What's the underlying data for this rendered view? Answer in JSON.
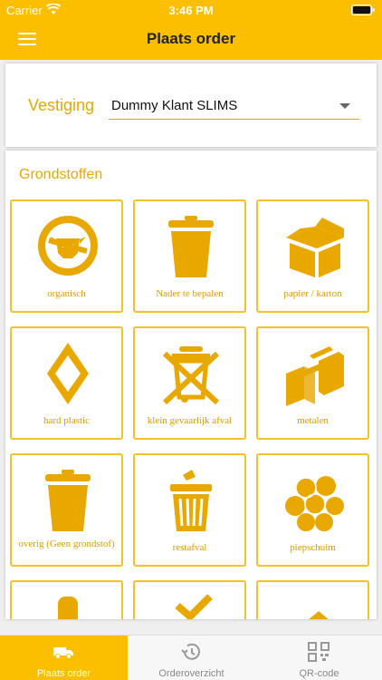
{
  "status_bar": {
    "carrier": "Carrier",
    "time": "3:46 PM"
  },
  "header": {
    "title": "Plaats order",
    "menu_icon": "hamburger-icon"
  },
  "branch": {
    "label": "Vestiging",
    "selected": "Dummy Klant SLIMS"
  },
  "materials": {
    "title": "Grondstoffen",
    "items": [
      {
        "label": "organisch",
        "icon": "no-cow-icon"
      },
      {
        "label": "Nader te bepalen",
        "icon": "bin-icon"
      },
      {
        "label": "papier / karton",
        "icon": "box-icon"
      },
      {
        "label": "hard plastic",
        "icon": "diamond-icon"
      },
      {
        "label": "klein gevaarlijk afval",
        "icon": "crossed-bin-icon"
      },
      {
        "label": "metalen",
        "icon": "metal-beams-icon"
      },
      {
        "label": "overig (Geen grondstof)",
        "icon": "bin-icon"
      },
      {
        "label": "restafval",
        "icon": "basket-bin-icon"
      },
      {
        "label": "piepschuim",
        "icon": "foam-balls-icon"
      }
    ]
  },
  "tabs": [
    {
      "label": "Plaats order",
      "icon": "truck-icon",
      "active": true
    },
    {
      "label": "Orderoverzicht",
      "icon": "history-icon",
      "active": false
    },
    {
      "label": "QR-code",
      "icon": "qr-code-icon",
      "active": false
    }
  ],
  "colors": {
    "accent": "#fcbf00",
    "icon": "#e8a800",
    "label": "#d99b00"
  }
}
